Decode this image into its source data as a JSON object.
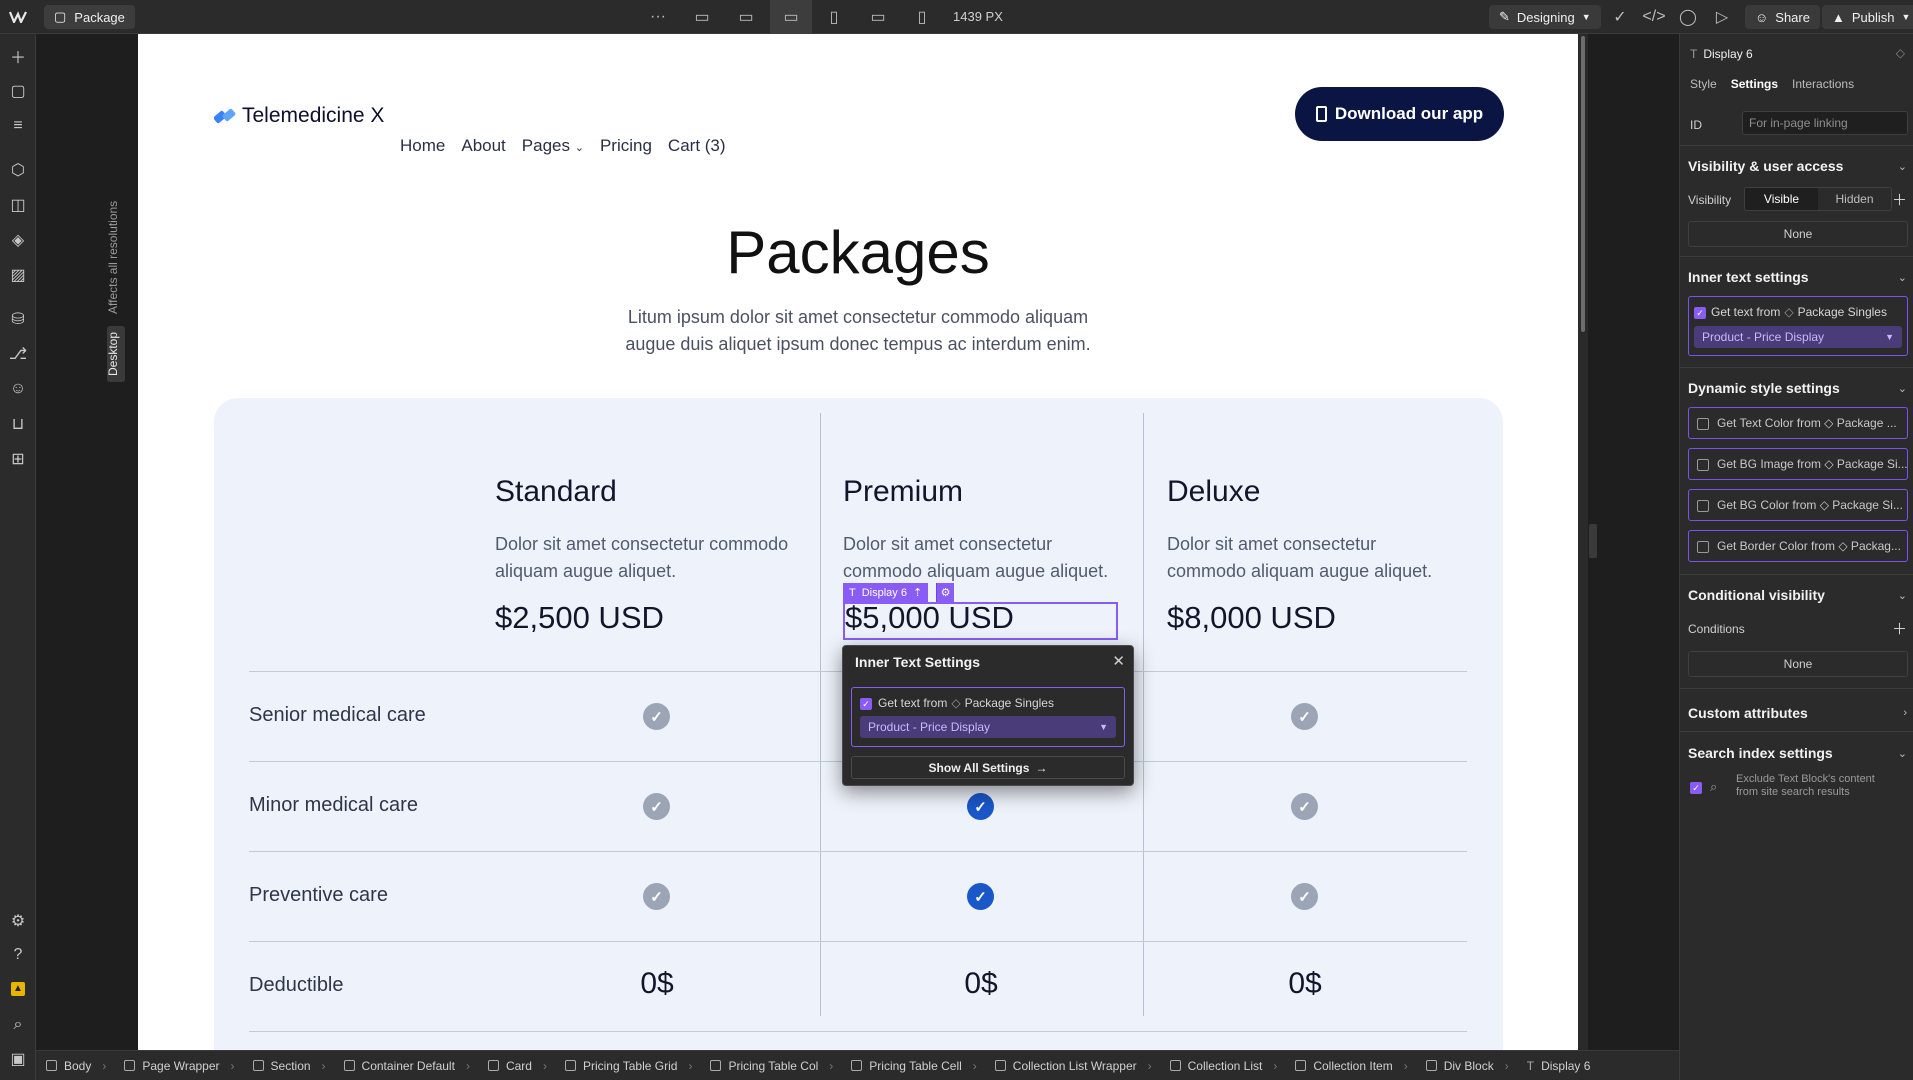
{
  "topbar": {
    "page_name": "Package",
    "more": "···",
    "width_label": "1439 PX",
    "mode": "Designing",
    "share": "Share",
    "publish": "Publish"
  },
  "canvas": {
    "affects_label": "Affects all resolutions",
    "breakpoint_tag": "Desktop"
  },
  "site": {
    "brand": "Telemedicine X",
    "nav": [
      "Home",
      "About",
      "Pages",
      "Pricing",
      "Cart (3)"
    ],
    "cta": "Download our app",
    "title": "Packages",
    "subtitle": "Litum ipsum dolor sit amet consectetur commodo aliquam augue duis aliquet ipsum donec tempus ac interdum enim.",
    "plans": [
      {
        "name": "Standard",
        "desc": "Dolor sit amet consectetur commodo aliquam augue aliquet.",
        "price": "$2,500 USD"
      },
      {
        "name": "Premium",
        "desc": "Dolor sit amet consectetur commodo aliquam augue aliquet.",
        "price": "$5,000 USD"
      },
      {
        "name": "Deluxe",
        "desc": "Dolor sit amet consectetur commodo aliquam augue aliquet.",
        "price": "$8,000 USD"
      }
    ],
    "rows": [
      {
        "label": "Senior medical care"
      },
      {
        "label": "Minor medical care"
      },
      {
        "label": "Preventive care"
      },
      {
        "label": "Deductible",
        "values": [
          "0$",
          "0$",
          "0$"
        ]
      }
    ]
  },
  "selection": {
    "tag": "Display 6"
  },
  "popup": {
    "title": "Inner Text Settings",
    "get_text_from": "Get text from",
    "collection": "Package Singles",
    "field": "Product - Price Display",
    "show_all": "Show All Settings"
  },
  "panel": {
    "element": "Display 6",
    "tabs": [
      "Style",
      "Settings",
      "Interactions"
    ],
    "id_label": "ID",
    "id_placeholder": "For in-page linking",
    "visibility_section": "Visibility & user access",
    "visibility_label": "Visibility",
    "visible": "Visible",
    "hidden": "Hidden",
    "none": "None",
    "inner_text_section": "Inner text settings",
    "get_text_from": "Get text from",
    "collection": "Package Singles",
    "field": "Product - Price Display",
    "dynamic_section": "Dynamic style settings",
    "dynamic_items": [
      "Get Text Color from ◇ Package ...",
      "Get BG Image from ◇ Package Si...",
      "Get BG Color from ◇ Package Si...",
      "Get Border Color from ◇ Packag..."
    ],
    "conditional_section": "Conditional visibility",
    "conditions_label": "Conditions",
    "custom_attr": "Custom attributes",
    "search_index": "Search index settings",
    "exclude_text": "Exclude Text Block's content",
    "exclude_text2": "from site search results"
  },
  "breadcrumbs": [
    "Body",
    "Page Wrapper",
    "Section",
    "Container Default",
    "Card",
    "Pricing Table Grid",
    "Pricing Table Col",
    "Pricing Table Cell",
    "Collection List Wrapper",
    "Collection List",
    "Collection Item",
    "Div Block",
    "Display 6"
  ]
}
